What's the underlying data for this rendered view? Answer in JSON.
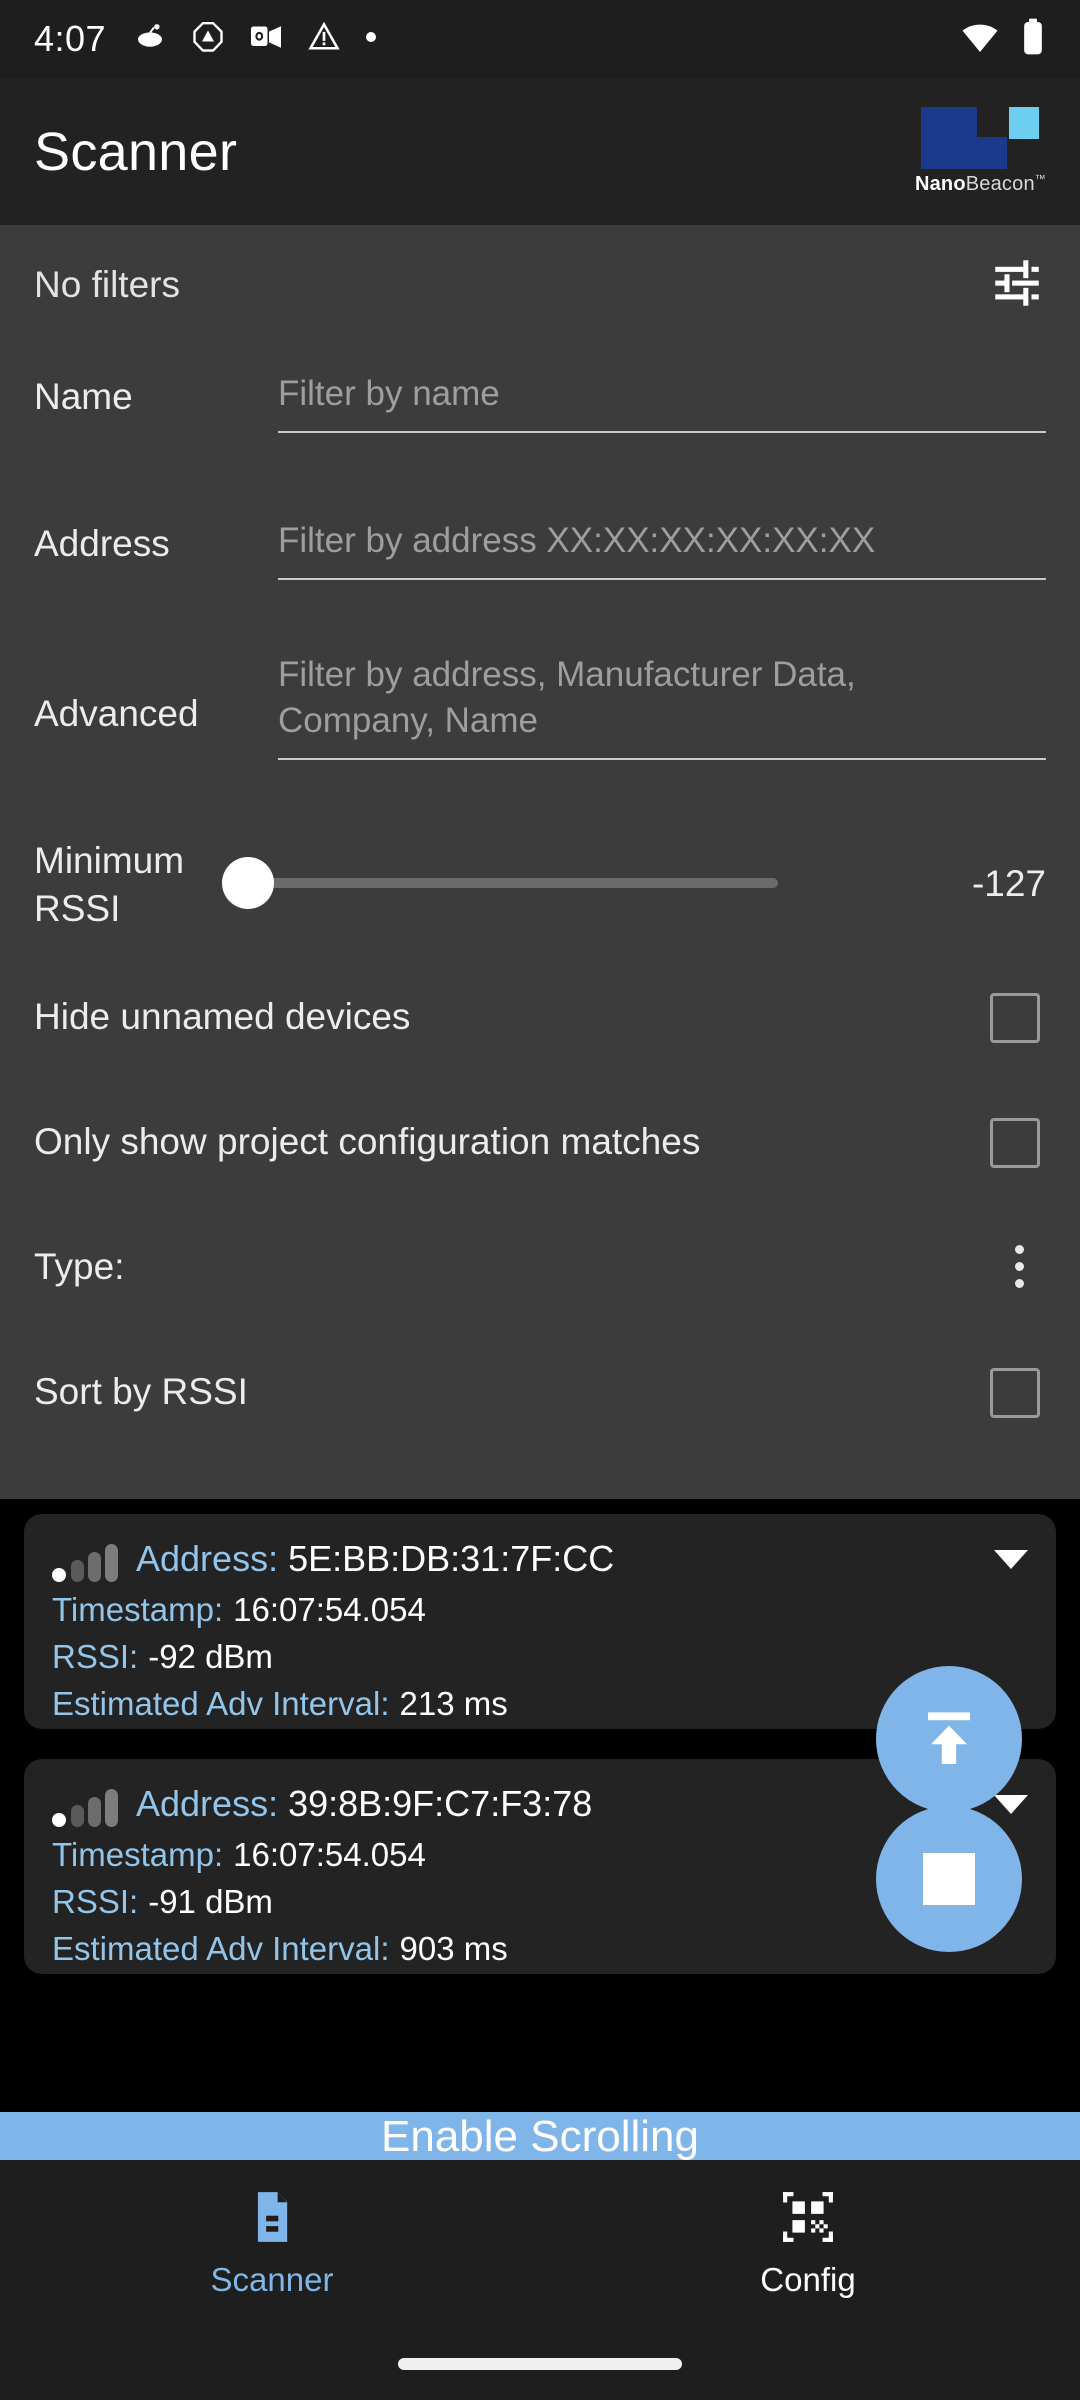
{
  "status_bar": {
    "time": "4:07",
    "left_icons": [
      "reddit-icon",
      "drive-icon",
      "outlook-icon",
      "warning-icon",
      "dot-icon"
    ],
    "right_icons": [
      "wifi-icon",
      "battery-icon"
    ]
  },
  "app_bar": {
    "title": "Scanner",
    "brand": {
      "bold": "Nano",
      "regular": "Beacon",
      "tm": "™"
    },
    "colors": {
      "brand_dark_blue": "#1B3A8C",
      "brand_cyan": "#6DCFF0"
    }
  },
  "filters": {
    "header_label": "No filters",
    "tune_icon": "tune-icon",
    "name": {
      "label": "Name",
      "placeholder": "Filter by name",
      "value": ""
    },
    "address": {
      "label": "Address",
      "placeholder": "Filter by address XX:XX:XX:XX:XX:XX",
      "value": ""
    },
    "advanced": {
      "label": "Advanced",
      "placeholder_line1": "Filter by address, Manufacturer Data,",
      "placeholder_line2": "Company, Name",
      "value": ""
    },
    "minimum_rssi": {
      "label_line1": "Minimum",
      "label_line2": "RSSI",
      "value": "-127",
      "min": -127,
      "max": 0
    },
    "hide_unnamed": {
      "label": "Hide unnamed devices",
      "checked": false
    },
    "only_project_matches": {
      "label": "Only show project configuration matches",
      "checked": false
    },
    "type": {
      "label": "Type:",
      "menu_icon": "kebab-menu-icon"
    },
    "sort_by_rssi": {
      "label": "Sort by RSSI",
      "checked": false
    }
  },
  "devices": [
    {
      "signal_icon": "signal-bars-icon",
      "address_label": "Address:",
      "address_value": "5E:BB:DB:31:7F:CC",
      "timestamp_label": "Timestamp:",
      "timestamp_value": "16:07:54.054",
      "rssi_label": "RSSI:",
      "rssi_value": "-92 dBm",
      "interval_label": "Estimated Adv Interval:",
      "interval_value": "213 ms",
      "expand_icon": "chevron-down-icon"
    },
    {
      "signal_icon": "signal-bars-icon",
      "address_label": "Address:",
      "address_value": "39:8B:9F:C7:F3:78",
      "timestamp_label": "Timestamp:",
      "timestamp_value": "16:07:54.054",
      "rssi_label": "RSSI:",
      "rssi_value": "-91 dBm",
      "interval_label": "Estimated Adv Interval:",
      "interval_value": "903 ms",
      "expand_icon": "chevron-down-icon"
    }
  ],
  "fabs": [
    {
      "name": "scroll-to-top-fab",
      "icon": "arrow-up-to-line-icon"
    },
    {
      "name": "stop-scan-fab",
      "icon": "stop-square-icon"
    }
  ],
  "banner": {
    "label": "Enable Scrolling",
    "color": "#7fb5e8"
  },
  "bottom_nav": {
    "items": [
      {
        "label": "Scanner",
        "icon": "document-icon",
        "active": true
      },
      {
        "label": "Config",
        "icon": "qr-code-icon",
        "active": false
      }
    ],
    "active_color": "#7fb5e8"
  }
}
